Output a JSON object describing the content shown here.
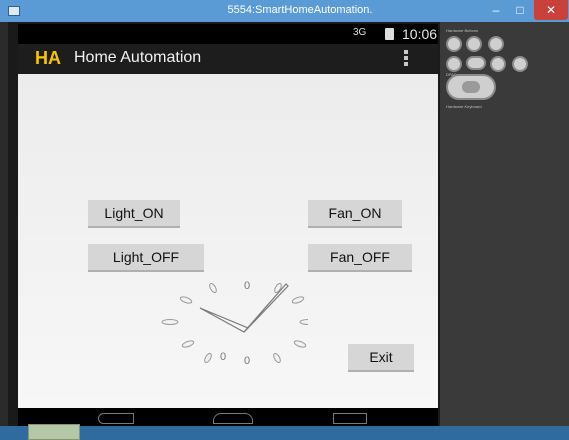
{
  "window": {
    "title": "5554:SmartHomeAutomation.",
    "minimize_glyph": "–",
    "maximize_glyph": "□",
    "close_glyph": "✕"
  },
  "status_bar": {
    "signal_label": "3G",
    "time": "10:06"
  },
  "action_bar": {
    "logo": "HA",
    "title": "Home Automation"
  },
  "buttons": {
    "light_on": "Light_ON",
    "fan_on": "Fan_ON",
    "light_off": "Light_OFF",
    "fan_off": "Fan_OFF",
    "exit": "Exit"
  },
  "analog_clock": {
    "hour_hand": 10,
    "minute_hand": 6,
    "dial_numbers": [
      "0",
      "0",
      "0"
    ]
  },
  "emulator_controls": {
    "section_labels": [
      "Hardware Buttons",
      "DPAD",
      "Hardware Keyboard"
    ],
    "buttons": [
      "volume-down",
      "volume-up",
      "power",
      "home",
      "menu",
      "back",
      "search"
    ],
    "dpad": "dpad"
  },
  "colors": {
    "logo": "#f7c600",
    "titlebar": "#5b9bd5",
    "close_button": "#c9413a",
    "taskbar": "#2f6b9e"
  }
}
